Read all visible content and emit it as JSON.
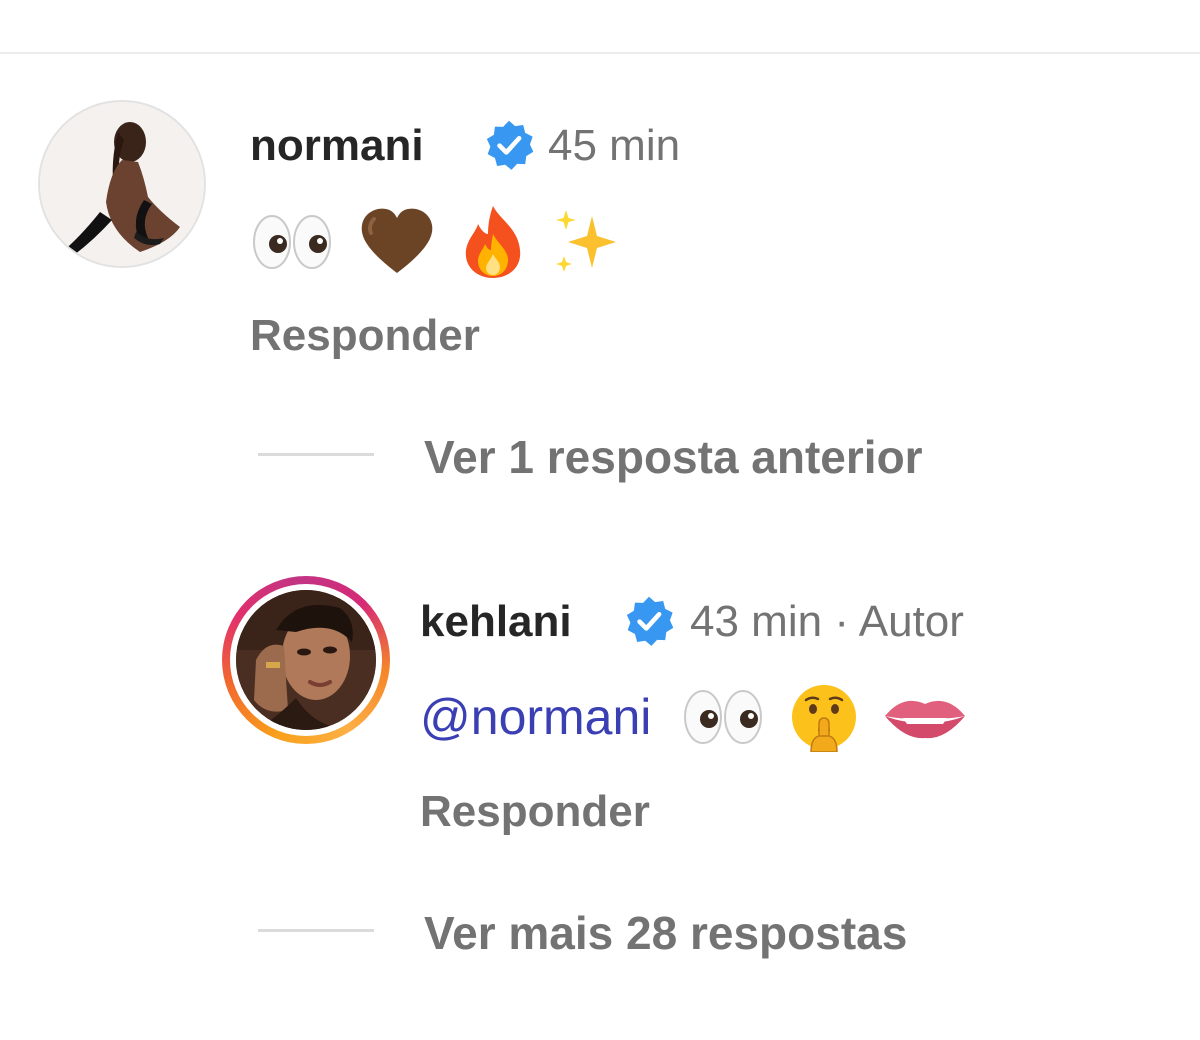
{
  "comments": [
    {
      "username": "normani",
      "verified": true,
      "time": "45 min",
      "emojis": [
        "eyes-emoji",
        "brown-heart-emoji",
        "fire-emoji",
        "sparkles-emoji"
      ],
      "reply_label": "Responder",
      "avatar_icon": "profile-photo"
    }
  ],
  "thread_previous_label": "Ver 1 resposta anterior",
  "replies": [
    {
      "username": "kehlani",
      "verified": true,
      "time": "43 min",
      "separator": "·",
      "author_tag": "Autor",
      "mention": "@normani",
      "emojis": [
        "eyes-emoji",
        "shushing-face-emoji",
        "biting-lip-emoji"
      ],
      "reply_label": "Responder",
      "avatar_icon": "profile-photo-story-ring"
    }
  ],
  "thread_more_label": "Ver mais 28 respostas",
  "colors": {
    "verified_badge": "#3897f0",
    "mention": "#3a3fb4",
    "secondary_text": "#737373",
    "primary_text": "#262626"
  }
}
